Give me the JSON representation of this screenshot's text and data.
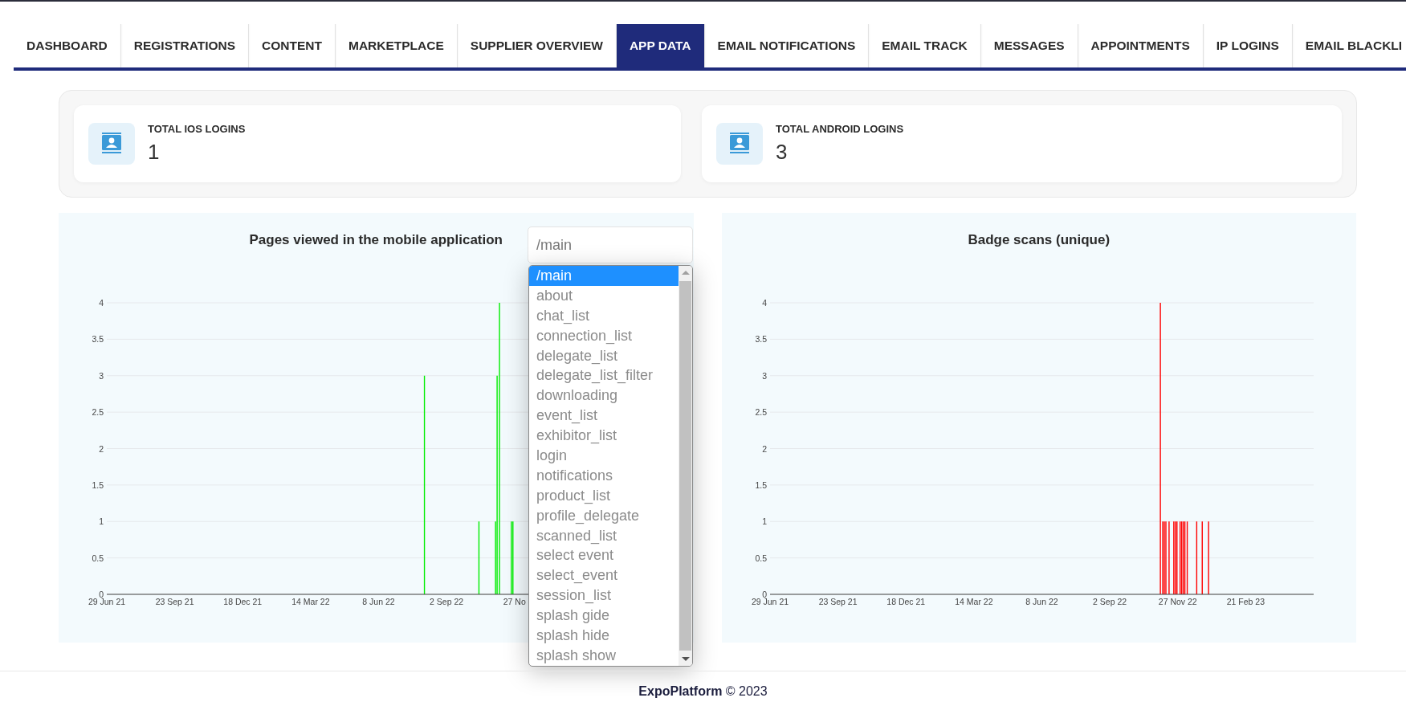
{
  "tabs": [
    {
      "label": "DASHBOARD",
      "selected": false
    },
    {
      "label": "REGISTRATIONS",
      "selected": false
    },
    {
      "label": "CONTENT",
      "selected": false
    },
    {
      "label": "MARKETPLACE",
      "selected": false
    },
    {
      "label": "SUPPLIER OVERVIEW",
      "selected": false
    },
    {
      "label": "APP DATA",
      "selected": true
    },
    {
      "label": "EMAIL NOTIFICATIONS",
      "selected": false
    },
    {
      "label": "EMAIL TRACK",
      "selected": false
    },
    {
      "label": "MESSAGES",
      "selected": false
    },
    {
      "label": "APPOINTMENTS",
      "selected": false
    },
    {
      "label": "IP LOGINS",
      "selected": false
    },
    {
      "label": "EMAIL BLACKLI",
      "selected": false
    }
  ],
  "stats": [
    {
      "label": "TOTAL IOS LOGINS",
      "value": "1"
    },
    {
      "label": "TOTAL ANDROID LOGINS",
      "value": "3"
    }
  ],
  "charts": [
    {
      "title": "Pages viewed in the mobile application",
      "chart_data": {
        "type": "bar",
        "grid": true,
        "xlim": [
          "2021-06-29",
          "2023-05-18"
        ],
        "ylim": [
          0,
          4
        ],
        "xticks": [
          {
            "value": "2021-06-29",
            "label": "29 Jun 21"
          },
          {
            "value": "2021-09-23",
            "label": "23 Sep 21"
          },
          {
            "value": "2021-12-18",
            "label": "18 Dec 21"
          },
          {
            "value": "2022-03-14",
            "label": "14 Mar 22"
          },
          {
            "value": "2022-06-08",
            "label": "8 Jun 22"
          },
          {
            "value": "2022-09-02",
            "label": "2 Sep 22"
          },
          {
            "value": "2022-11-27",
            "label": "27 No"
          }
        ],
        "yticks": [
          0,
          0.5,
          1,
          1.5,
          2,
          2.5,
          3,
          3.5,
          4
        ],
        "x": [
          "2022-08-05",
          "2022-10-13",
          "2022-11-03",
          "2022-11-05",
          "2022-11-08",
          "2022-11-23",
          "2022-11-25"
        ],
        "series": [
          {
            "color": "#00ee00",
            "values": [
              3,
              1,
              1,
              3,
              4,
              1,
              1
            ]
          }
        ]
      }
    },
    {
      "title": "Badge scans (unique)",
      "chart_data": {
        "type": "bar",
        "grid": true,
        "xlim": [
          "2021-06-29",
          "2023-05-18"
        ],
        "ylim": [
          0,
          4
        ],
        "xticks": [
          {
            "value": "2021-06-29",
            "label": "29 Jun 21"
          },
          {
            "value": "2021-09-23",
            "label": "23 Sep 21"
          },
          {
            "value": "2021-12-18",
            "label": "18 Dec 21"
          },
          {
            "value": "2022-03-14",
            "label": "14 Mar 22"
          },
          {
            "value": "2022-06-08",
            "label": "8 Jun 22"
          },
          {
            "value": "2022-09-02",
            "label": "2 Sep 22"
          },
          {
            "value": "2022-11-27",
            "label": "27 Nov 22"
          },
          {
            "value": "2023-02-21",
            "label": "21 Feb 23"
          }
        ],
        "yticks": [
          0,
          0.5,
          1,
          1.5,
          2,
          2.5,
          3,
          3.5,
          4
        ],
        "x": [
          "2022-11-05",
          "2022-11-08",
          "2022-11-10",
          "2022-11-12",
          "2022-11-16",
          "2022-11-22",
          "2022-11-24",
          "2022-11-26",
          "2022-11-30",
          "2022-12-02",
          "2022-12-04",
          "2022-12-06",
          "2022-12-09",
          "2022-12-21",
          "2022-12-28",
          "2023-01-05"
        ],
        "series": [
          {
            "color": "#ff0000",
            "values": [
              4,
              1,
              1,
              1,
              1,
              1,
              1,
              1,
              1,
              1,
              1,
              1,
              1,
              1,
              1,
              1
            ]
          }
        ]
      }
    }
  ],
  "page_select": {
    "value": "/main",
    "options": [
      {
        "label": "/main",
        "selected": true
      },
      {
        "label": "about",
        "selected": false
      },
      {
        "label": "chat_list",
        "selected": false
      },
      {
        "label": "connection_list",
        "selected": false
      },
      {
        "label": "delegate_list",
        "selected": false
      },
      {
        "label": "delegate_list_filter",
        "selected": false
      },
      {
        "label": "downloading",
        "selected": false
      },
      {
        "label": "event_list",
        "selected": false
      },
      {
        "label": "exhibitor_list",
        "selected": false
      },
      {
        "label": "login",
        "selected": false
      },
      {
        "label": "notifications",
        "selected": false
      },
      {
        "label": "product_list",
        "selected": false
      },
      {
        "label": "profile_delegate",
        "selected": false
      },
      {
        "label": "scanned_list",
        "selected": false
      },
      {
        "label": "select event",
        "selected": false
      },
      {
        "label": "select_event",
        "selected": false
      },
      {
        "label": "session_list",
        "selected": false
      },
      {
        "label": "splash gide",
        "selected": false
      },
      {
        "label": "splash hide",
        "selected": false
      },
      {
        "label": "splash show",
        "selected": false
      }
    ]
  },
  "footer": "**ExpoPlatform** © 2023"
}
